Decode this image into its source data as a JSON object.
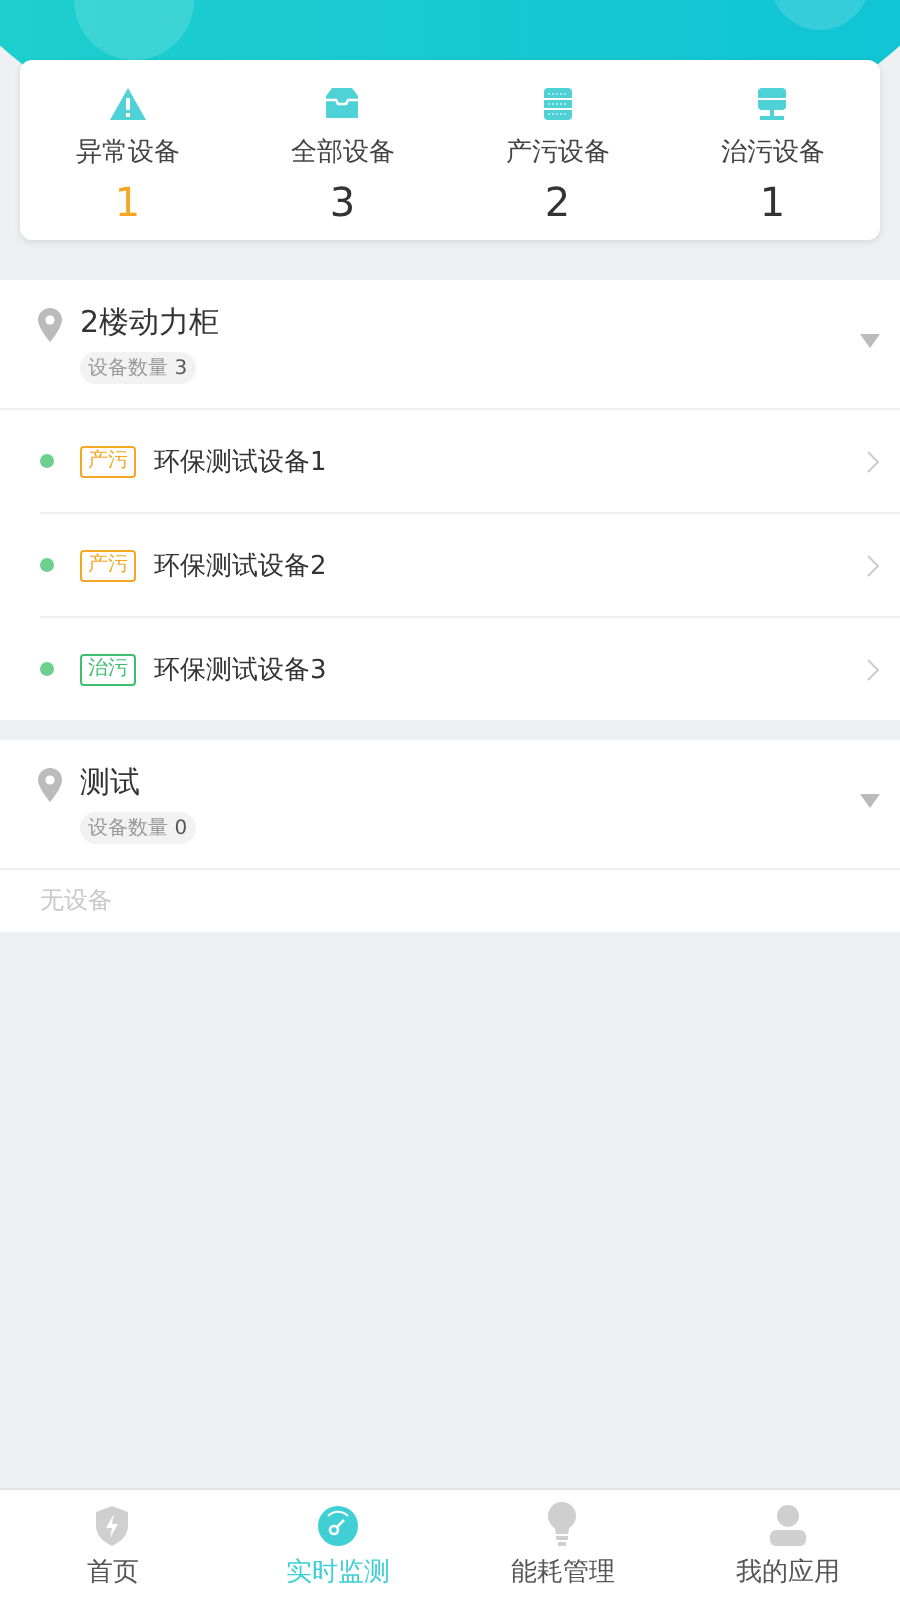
{
  "summary": [
    {
      "kind": "warning",
      "label": "异常设备",
      "count": "1",
      "color": "#f5a623"
    },
    {
      "kind": "box",
      "label": "全部设备",
      "count": "3",
      "color": "#333333"
    },
    {
      "kind": "server",
      "label": "产污设备",
      "count": "2",
      "color": "#333333"
    },
    {
      "kind": "server-stand",
      "label": "治污设备",
      "count": "1",
      "color": "#333333"
    }
  ],
  "groups": [
    {
      "name": "2楼动力柜",
      "count_label": "设备数量",
      "count": "3",
      "expanded": true,
      "devices": [
        {
          "color": "#6fcf8f",
          "tag": "产污",
          "kind": "produce",
          "name": "环保测试设备1"
        },
        {
          "color": "#6fcf8f",
          "tag": "产污",
          "kind": "produce",
          "name": "环保测试设备2"
        },
        {
          "color": "#6fcf8f",
          "tag": "治污",
          "kind": "treat",
          "name": "环保测试设备3"
        }
      ]
    },
    {
      "name": "测试",
      "count_label": "设备数量",
      "count": "0",
      "expanded": true,
      "empty_text": "无设备"
    }
  ],
  "tabs": [
    {
      "kind": "shield",
      "label": "首页",
      "selected": false
    },
    {
      "kind": "gauge",
      "label": "实时监测",
      "selected": true
    },
    {
      "kind": "bulb",
      "label": "能耗管理",
      "selected": false
    },
    {
      "kind": "person",
      "label": "我的应用",
      "selected": false
    }
  ]
}
